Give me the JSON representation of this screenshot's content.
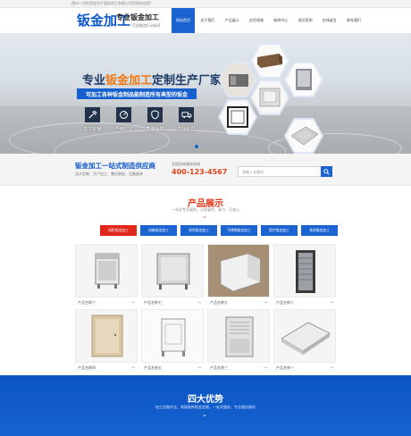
{
  "topbar": {
    "text": "德州一次性钣金生产服务加工有限公司官网欢迎您！"
  },
  "header": {
    "logo": "钣金加工",
    "slogan": "专业钣金加工",
    "slogan_sub": "打造制造行业标杆"
  },
  "nav": {
    "items": [
      {
        "label": "网站首页"
      },
      {
        "label": "关于我们"
      },
      {
        "label": "产品展示"
      },
      {
        "label": "应用领域"
      },
      {
        "label": "新闻中心"
      },
      {
        "label": "成功案例"
      },
      {
        "label": "在线留言"
      },
      {
        "label": "联系我们"
      }
    ]
  },
  "banner": {
    "title_pre": "专业",
    "title_hl": "钣金加工",
    "title_post": "定制生产厂家",
    "subtitle": "可加工各种钣金制品能制造所有典型的钣金",
    "features": [
      {
        "label": "加工定制",
        "icon": "tools-icon"
      },
      {
        "label": "严格把控",
        "icon": "gauge-icon"
      },
      {
        "label": "质量保障",
        "icon": "shield-icon"
      },
      {
        "label": "支持配送",
        "icon": "truck-icon"
      }
    ]
  },
  "strip": {
    "title": "钣金加工一站式制造供应商",
    "subtitle": "设计定制、生产加工、整机装配、设备维修",
    "phone_label": "全国咨询服务热线",
    "phone": "400-123-4567",
    "search_placeholder": "请输入关键词"
  },
  "products": {
    "title": "产品展示",
    "subtitle": "一站式专业服务，让您省时、省力、又省心",
    "categories": [
      {
        "label": "机柜钣金加工"
      },
      {
        "label": "机箱钣金加工"
      },
      {
        "label": "机壳钣金加工"
      },
      {
        "label": "不锈钢钣金加工"
      },
      {
        "label": "医疗钣金加工"
      },
      {
        "label": "其他钣金加工"
      }
    ],
    "items": [
      {
        "name": "产品名称六"
      },
      {
        "name": "产品名称七"
      },
      {
        "name": "产品名称九"
      },
      {
        "name": "产品名称八"
      },
      {
        "name": "产品名称四"
      },
      {
        "name": "产品名称五"
      },
      {
        "name": "产品名称三"
      },
      {
        "name": "产品名称一"
      }
    ]
  },
  "advantages": {
    "title": "四大优势",
    "subtitle": "加工设备齐全、承接各种钣金定制、一站式服务、专业服务指导"
  },
  "colors": {
    "brand_blue": "#1a63d1",
    "accent_red": "#e1261c",
    "accent_orange": "#f07a12"
  }
}
